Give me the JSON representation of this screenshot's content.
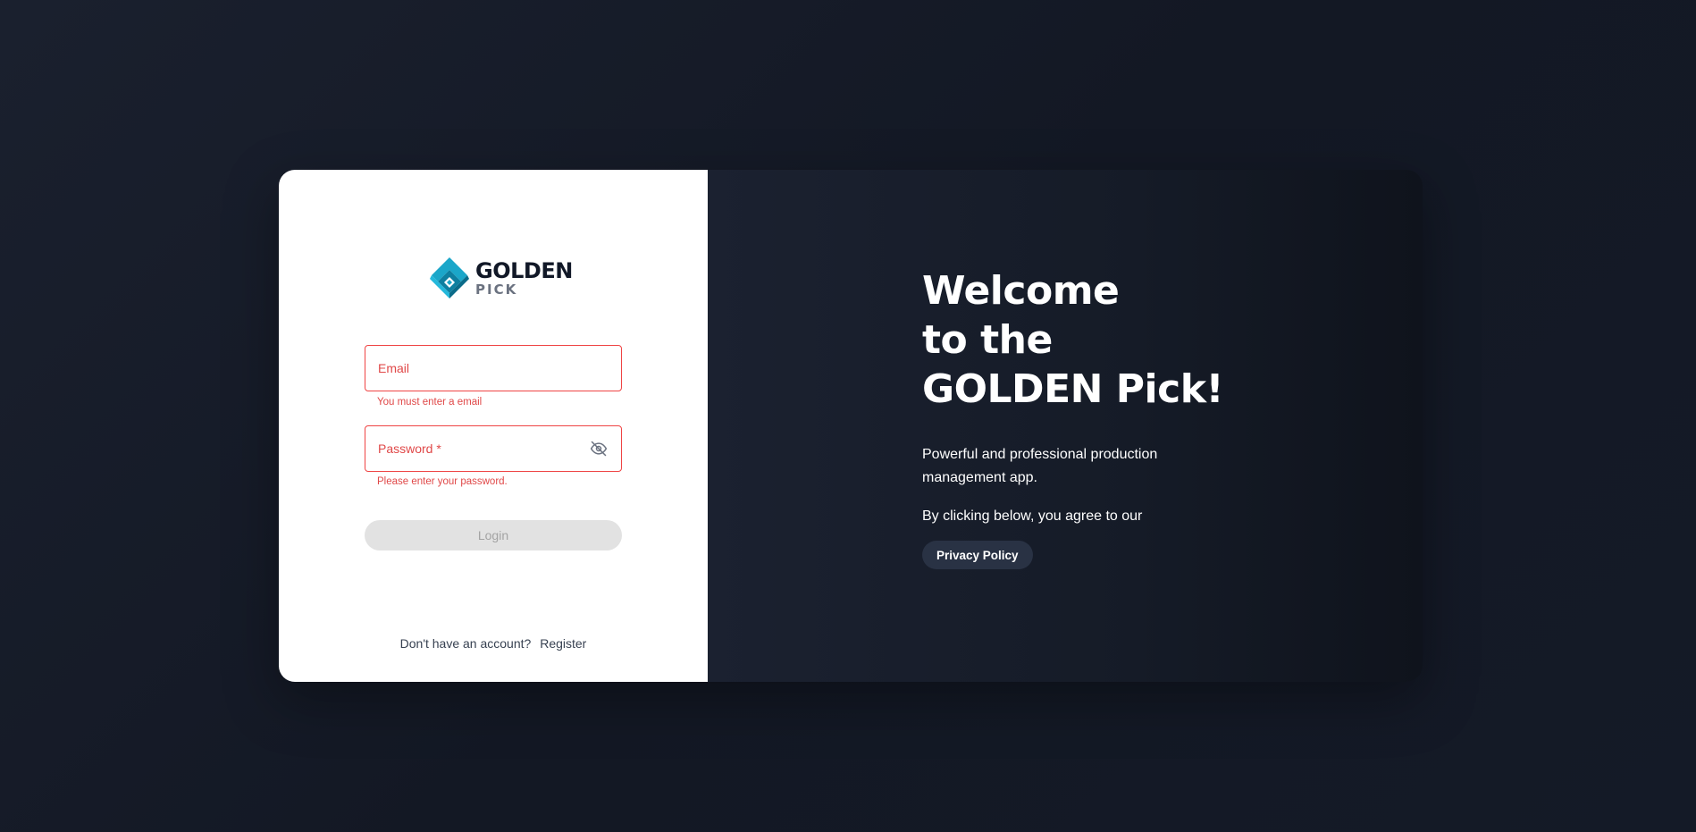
{
  "brand": {
    "name_top": "GOLDEN",
    "name_bottom": "PICK",
    "logo_icon": "golden-pick-logo-icon",
    "colors": {
      "logo_primary": "#1ba6c9",
      "logo_dark": "#0e7fa0",
      "logo_text": "#111827",
      "logo_subtext": "#6b7280"
    }
  },
  "login_form": {
    "email": {
      "label": "Email",
      "error": "You must enter a email"
    },
    "password": {
      "label": "Password *",
      "error": "Please enter your password.",
      "toggle_icon": "eye-off-icon"
    },
    "login_button": "Login",
    "register_prompt": "Don't have an account?",
    "register_link": "Register",
    "colors": {
      "error": "#e04848",
      "button_disabled_bg": "#e2e2e2",
      "button_disabled_text": "#a3a3a3"
    }
  },
  "hero": {
    "title_lines": [
      "Welcome",
      "to the",
      "GOLDEN Pick!"
    ],
    "tagline": "Powerful and professional production management app.",
    "agree_text": "By clicking below, you agree to our",
    "privacy_button": "Privacy Policy",
    "colors": {
      "background": "#161c28",
      "text": "#ffffff",
      "pill_bg": "#293244"
    }
  }
}
